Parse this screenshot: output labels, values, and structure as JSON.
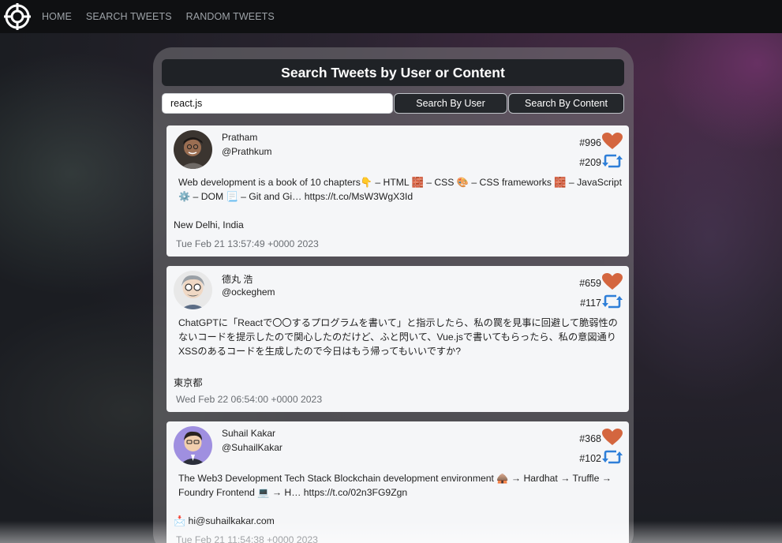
{
  "nav": {
    "items": [
      "HOME",
      "SEARCH TWEETS",
      "RANDOM TWEETS"
    ]
  },
  "search": {
    "title": "Search Tweets by User or Content",
    "query": "react.js",
    "by_user_label": "Search By User",
    "by_content_label": "Search By Content"
  },
  "colors": {
    "heart": "#d4663f",
    "retweet": "#2f7fd8",
    "title_bar": "#1f2226"
  },
  "tweets": [
    {
      "name": "Pratham",
      "handle": "@Prathkum",
      "likes": "#996",
      "retweets": "#209",
      "text": "Web development is a book of 10 chapters👇 – HTML 🧱 – CSS 🎨 – CSS frameworks 🧱 – JavaScript ⚙️ – DOM 📃 – Git and Gi… https://t.co/MsW3WgX3Id",
      "location": "New Delhi, India",
      "date": "Tue Feb 21 13:57:49 +0000 2023"
    },
    {
      "name": "德丸 浩",
      "handle": "@ockeghem",
      "likes": "#659",
      "retweets": "#117",
      "text": "ChatGPTに「Reactで〇〇するプログラムを書いて」と指示したら、私の罠を見事に回避して脆弱性のないコードを提示したので関心したのだけど、ふと閃いて、Vue.jsで書いてもらったら、私の意図通りXSSのあるコードを生成したので今日はもう帰ってもいいですか?",
      "location": "東京都",
      "date": "Wed Feb 22 06:54:00 +0000 2023"
    },
    {
      "name": "Suhail Kakar",
      "handle": "@SuhailKakar",
      "likes": "#368",
      "retweets": "#102",
      "text": "The Web3 Development Tech Stack Blockchain development environment 🛖 → Hardhat → Truffle → Foundry Frontend 💻 → H… https://t.co/02n3FG9Zgn",
      "location": "📩 hi@suhailkakar.com",
      "date": "Tue Feb 21 11:54:38 +0000 2023"
    }
  ]
}
